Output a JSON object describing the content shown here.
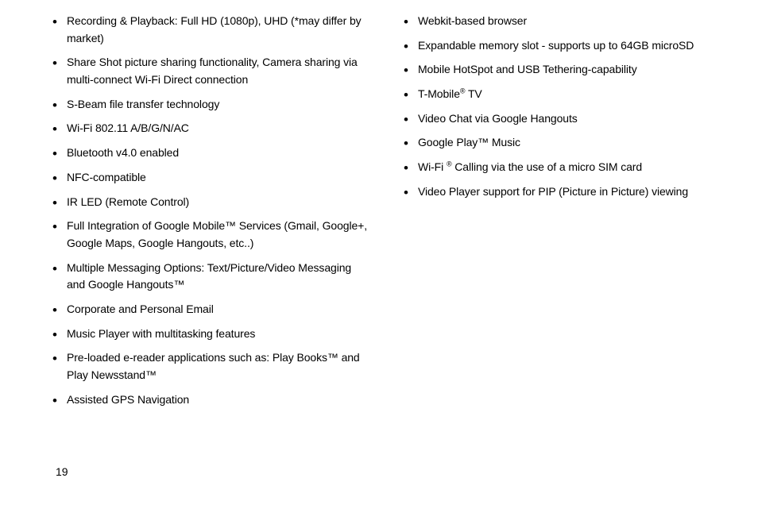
{
  "page_number": "19",
  "left_column": {
    "items": [
      {
        "html": "Recording & Playback: Full HD (1080p), UHD (*may differ by market)"
      },
      {
        "html": "Share Shot picture sharing functionality, Camera sharing via multi-connect Wi-Fi Direct connection"
      },
      {
        "html": "S-Beam file transfer technology"
      },
      {
        "html": "Wi-Fi 802.11 A/B/G/N/AC"
      },
      {
        "html": "Bluetooth  v4.0 enabled"
      },
      {
        "html": "NFC-compatible"
      },
      {
        "html": "IR LED (Remote Control)"
      },
      {
        "html": "Full Integration of Google Mobile™ Services (Gmail, Google+, Google Maps, Google Hangouts, etc..)"
      },
      {
        "html": "Multiple Messaging Options: Text/Picture/Video Messaging and Google Hangouts™"
      },
      {
        "html": "Corporate and Personal Email"
      },
      {
        "html": "Music Player with multitasking features"
      },
      {
        "html": "Pre-loaded e-reader applications such as: Play Books™  and Play Newsstand™"
      },
      {
        "html": "Assisted GPS Navigation"
      }
    ]
  },
  "right_column": {
    "items": [
      {
        "html": "Webkit-based browser"
      },
      {
        "html": "Expandable memory slot - supports up to 64GB microSD"
      },
      {
        "html": "Mobile HotSpot and USB Tethering-capability"
      },
      {
        "html": "T-Mobile<span class=\"sup\">®</span> TV"
      },
      {
        "html": "Video Chat via Google Hangouts"
      },
      {
        "html": "Google Play™ Music"
      },
      {
        "html": "Wi-Fi <span class=\"sup\">®</span> Calling via the use of a micro SIM card"
      },
      {
        "html": "Video Player support for PIP (Picture in Picture) viewing"
      }
    ]
  }
}
